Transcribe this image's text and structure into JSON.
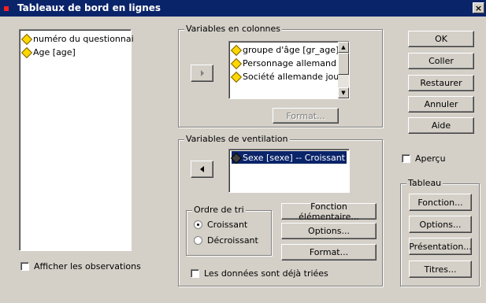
{
  "window": {
    "title": "Tableaux de bord en lignes",
    "close_glyph": "×"
  },
  "source_list": {
    "items": [
      {
        "label": "numéro du questionnai",
        "icon": "variable-icon"
      },
      {
        "label": "Age [age]",
        "icon": "variable-icon"
      }
    ]
  },
  "columns_group": {
    "legend": "Variables en colonnes",
    "items": [
      {
        "label": "groupe d'âge [gr_age]"
      },
      {
        "label": "Personnage allemand"
      },
      {
        "label": "Société allemande jou"
      }
    ],
    "format_button": "Format..."
  },
  "breakdown_group": {
    "legend": "Variables de ventilation",
    "items": [
      {
        "label": "Sexe [sexe] -- Croissant"
      }
    ],
    "sort_order": {
      "legend": "Ordre de tri",
      "options": [
        {
          "label": "Croissant",
          "selected": true
        },
        {
          "label": "Décroissant",
          "selected": false
        }
      ]
    },
    "function_button": "Fonction élémentaire...",
    "options_button": "Options...",
    "format_button": "Format...",
    "presorted_checkbox": {
      "label": "Les données sont déjà triées",
      "checked": false
    }
  },
  "buttons": {
    "ok": "OK",
    "paste": "Coller",
    "reset": "Restaurer",
    "cancel": "Annuler",
    "help": "Aide"
  },
  "preview_checkbox": {
    "label": "Aperçu",
    "checked": false
  },
  "table_group": {
    "legend": "Tableau",
    "function_button": "Fonction...",
    "options_button": "Options...",
    "layout_button": "Présentation...",
    "titles_button": "Titres..."
  },
  "show_cases_checkbox": {
    "label": "Afficher les observations",
    "checked": false
  }
}
